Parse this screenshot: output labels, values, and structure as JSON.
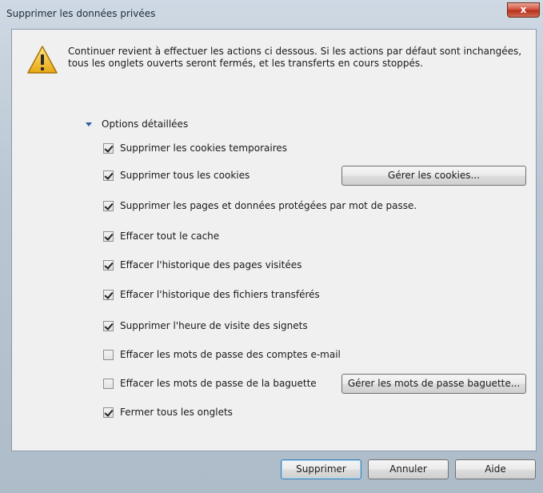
{
  "window": {
    "title": "Supprimer les données privées",
    "close_label": "x"
  },
  "intro_text": "Continuer revient à effectuer les actions ci dessous. Si les actions par défaut sont inchangées, tous les onglets ouverts seront fermés, et les transferts en cours stoppés.",
  "options_header": "Options détaillées",
  "options": [
    {
      "label": "Supprimer les cookies temporaires",
      "checked": true
    },
    {
      "label": "Supprimer tous les cookies",
      "checked": true
    },
    {
      "label": "Supprimer les pages et données protégées par mot de passe.",
      "checked": true
    },
    {
      "label": "Effacer tout le cache",
      "checked": true
    },
    {
      "label": "Effacer l'historique des pages visitées",
      "checked": true
    },
    {
      "label": "Effacer l'historique des fichiers transférés",
      "checked": true
    },
    {
      "label": "Supprimer l'heure de visite des signets",
      "checked": true
    },
    {
      "label": "Effacer les mots de passe des comptes e-mail",
      "checked": false
    },
    {
      "label": "Effacer les mots de passe de la baguette",
      "checked": false
    },
    {
      "label": "Fermer tous les onglets",
      "checked": true
    }
  ],
  "buttons": {
    "manage_cookies": "Gérer les cookies...",
    "manage_wand": "Gérer les mots de passe baguette...",
    "delete": "Supprimer",
    "cancel": "Annuler",
    "help": "Aide"
  },
  "colors": {
    "accent": "#2a5fa8",
    "warning": "#f3c12c"
  },
  "icons": {
    "warning": "warning-icon",
    "expand": "triangle-down-icon",
    "close": "close-icon"
  }
}
